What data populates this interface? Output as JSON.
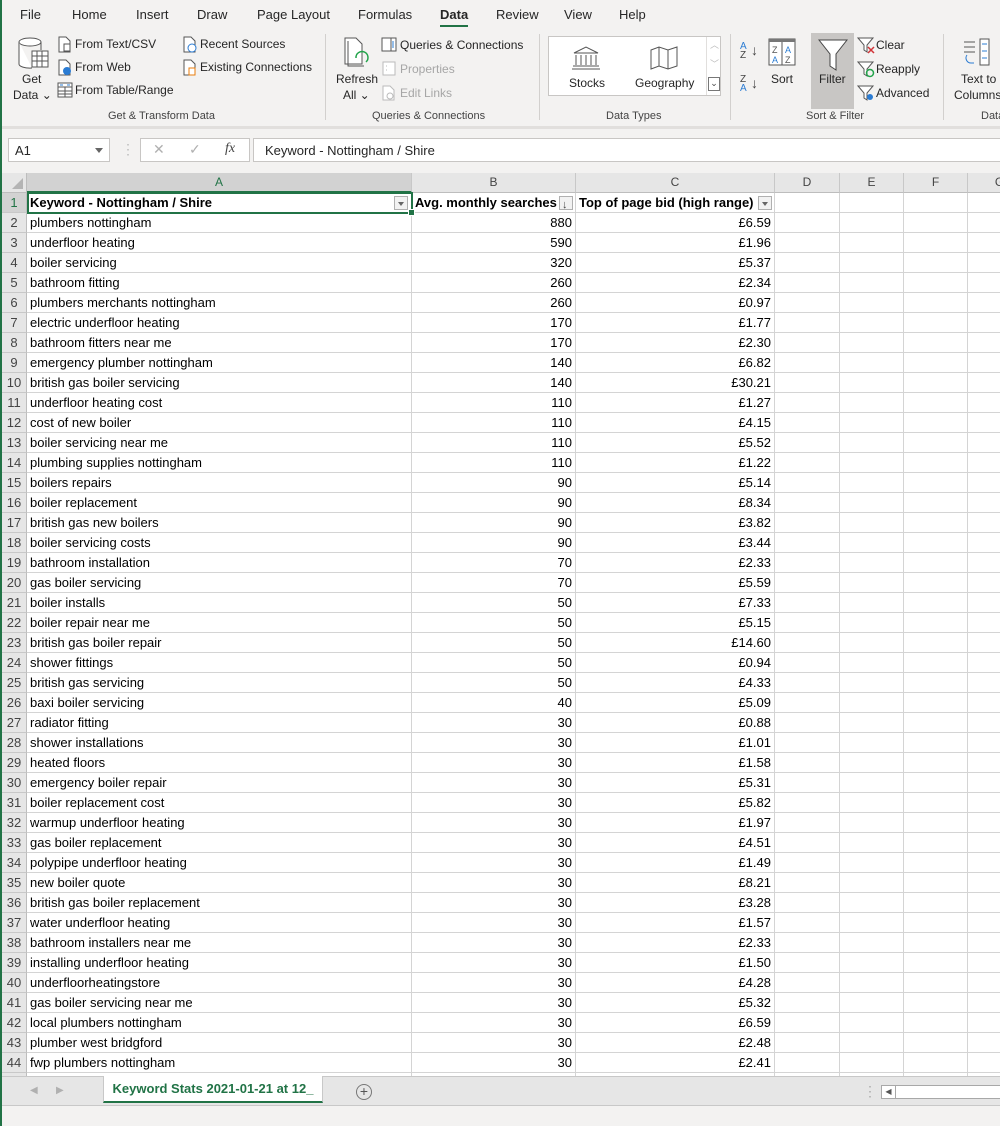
{
  "menu": {
    "tabs": [
      "File",
      "Home",
      "Insert",
      "Draw",
      "Page Layout",
      "Formulas",
      "Data",
      "Review",
      "View",
      "Help"
    ],
    "active": "Data"
  },
  "ribbon": {
    "get_transform": {
      "get_data": [
        "Get",
        "Data"
      ],
      "from_text_csv": "From Text/CSV",
      "from_web": "From Web",
      "from_table_range": "From Table/Range",
      "recent_sources": "Recent Sources",
      "existing_connections": "Existing Connections",
      "group_label": "Get & Transform Data"
    },
    "queries": {
      "refresh_all": [
        "Refresh",
        "All"
      ],
      "queries_connections": "Queries & Connections",
      "properties": "Properties",
      "edit_links": "Edit Links",
      "group_label": "Queries & Connections"
    },
    "data_types": {
      "stocks": "Stocks",
      "geography": "Geography",
      "group_label": "Data Types"
    },
    "sort_filter": {
      "sort_az": "A→Z",
      "sort_za": "Z→A",
      "sort": "Sort",
      "filter": "Filter",
      "clear": "Clear",
      "reapply": "Reapply",
      "advanced": "Advanced",
      "group_label": "Sort & Filter"
    },
    "data_tools": {
      "text_to_columns": [
        "Text to",
        "Columns"
      ],
      "group_label": "Data"
    }
  },
  "formula_bar": {
    "name_box": "A1",
    "cancel": "✕",
    "enter": "✓",
    "fx": "fx",
    "value": "Keyword - Nottingham / Shire"
  },
  "sheet": {
    "columns": [
      "A",
      "B",
      "C",
      "D",
      "E",
      "F",
      "G"
    ],
    "headers": [
      "Keyword - Nottingham / Shire",
      "Avg. monthly searches",
      "Top of page bid (high range)"
    ],
    "rows": [
      [
        "plumbers nottingham",
        "880",
        "£6.59"
      ],
      [
        "underfloor heating",
        "590",
        "£1.96"
      ],
      [
        "boiler servicing",
        "320",
        "£5.37"
      ],
      [
        "bathroom fitting",
        "260",
        "£2.34"
      ],
      [
        "plumbers merchants nottingham",
        "260",
        "£0.97"
      ],
      [
        "electric underfloor heating",
        "170",
        "£1.77"
      ],
      [
        "bathroom fitters near me",
        "170",
        "£2.30"
      ],
      [
        "emergency plumber nottingham",
        "140",
        "£6.82"
      ],
      [
        "british gas boiler servicing",
        "140",
        "£30.21"
      ],
      [
        "underfloor heating cost",
        "110",
        "£1.27"
      ],
      [
        "cost of new boiler",
        "110",
        "£4.15"
      ],
      [
        "boiler servicing near me",
        "110",
        "£5.52"
      ],
      [
        "plumbing supplies nottingham",
        "110",
        "£1.22"
      ],
      [
        "boilers repairs",
        "90",
        "£5.14"
      ],
      [
        "boiler replacement",
        "90",
        "£8.34"
      ],
      [
        "british gas new boilers",
        "90",
        "£3.82"
      ],
      [
        "boiler servicing costs",
        "90",
        "£3.44"
      ],
      [
        "bathroom installation",
        "70",
        "£2.33"
      ],
      [
        "gas boiler servicing",
        "70",
        "£5.59"
      ],
      [
        "boiler installs",
        "50",
        "£7.33"
      ],
      [
        "boiler repair near me",
        "50",
        "£5.15"
      ],
      [
        "british gas boiler repair",
        "50",
        "£14.60"
      ],
      [
        "shower fittings",
        "50",
        "£0.94"
      ],
      [
        "british gas servicing",
        "50",
        "£4.33"
      ],
      [
        "baxi boiler servicing",
        "40",
        "£5.09"
      ],
      [
        "radiator fitting",
        "30",
        "£0.88"
      ],
      [
        "shower installations",
        "30",
        "£1.01"
      ],
      [
        "heated floors",
        "30",
        "£1.58"
      ],
      [
        "emergency boiler repair",
        "30",
        "£5.31"
      ],
      [
        "boiler replacement cost",
        "30",
        "£5.82"
      ],
      [
        "warmup underfloor heating",
        "30",
        "£1.97"
      ],
      [
        "gas boiler replacement",
        "30",
        "£4.51"
      ],
      [
        "polypipe underfloor heating",
        "30",
        "£1.49"
      ],
      [
        "new boiler quote",
        "30",
        "£8.21"
      ],
      [
        "british gas boiler replacement",
        "30",
        "£3.28"
      ],
      [
        "water underfloor heating",
        "30",
        "£1.57"
      ],
      [
        "bathroom installers near me",
        "30",
        "£2.33"
      ],
      [
        "installing underfloor heating",
        "30",
        "£1.50"
      ],
      [
        "underfloorheatingstore",
        "30",
        "£4.28"
      ],
      [
        "gas boiler servicing near me",
        "30",
        "£5.32"
      ],
      [
        "local plumbers nottingham",
        "30",
        "£6.59"
      ],
      [
        "plumber west bridgford",
        "30",
        "£2.48"
      ],
      [
        "fwp plumbers nottingham",
        "30",
        "£2.41"
      ]
    ],
    "sorted_column": "B",
    "sort_direction": "descending"
  },
  "sheet_tabs": {
    "active": "Keyword Stats 2021-01-21 at 12_",
    "add_label": "+"
  },
  "colors": {
    "accent": "#217346"
  }
}
